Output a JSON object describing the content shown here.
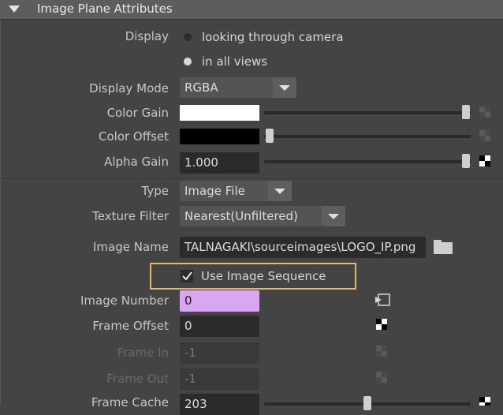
{
  "section": {
    "title": "Image Plane Attributes"
  },
  "display": {
    "label": "Display",
    "options": [
      "looking through camera",
      "in all views"
    ],
    "selected_index": 1
  },
  "display_mode": {
    "label": "Display Mode",
    "value": "RGBA"
  },
  "color_gain": {
    "label": "Color Gain",
    "swatch": "#ffffff"
  },
  "color_offset": {
    "label": "Color Offset",
    "swatch": "#000000"
  },
  "alpha_gain": {
    "label": "Alpha Gain",
    "value": "1.000"
  },
  "type": {
    "label": "Type",
    "value": "Image File"
  },
  "texture_filter": {
    "label": "Texture Filter",
    "value": "Nearest(Unfiltered)"
  },
  "image_name": {
    "label": "Image Name",
    "value": "TALNAGAKI\\sourceimages\\LOGO_IP.png"
  },
  "use_image_sequence": {
    "label": "Use Image Sequence",
    "checked": true,
    "highlight_color": "#e8b86a"
  },
  "image_number": {
    "label": "Image Number",
    "value": "0",
    "field_color": "#d9a7f0"
  },
  "frame_offset": {
    "label": "Frame Offset",
    "value": "0"
  },
  "frame_in": {
    "label": "Frame In",
    "value": "-1"
  },
  "frame_out": {
    "label": "Frame Out",
    "value": "-1"
  },
  "frame_cache": {
    "label": "Frame Cache",
    "value": "203"
  }
}
